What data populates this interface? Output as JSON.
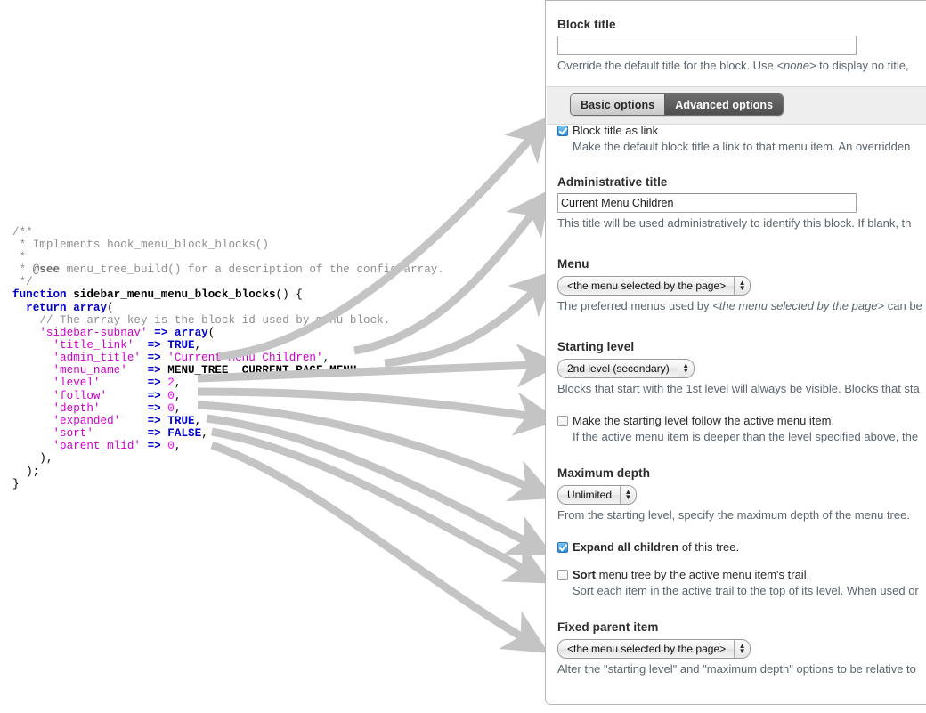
{
  "code": {
    "language": "php",
    "lines": [
      "/**",
      " * Implements hook_menu_block_blocks()",
      " *",
      " * @see menu_tree_build() for a description of the config array.",
      " */",
      "function sidebar_menu_menu_block_blocks() {",
      "  return array(",
      "    // The array key is the block id used by menu block.",
      "    'sidebar-subnav' => array(",
      "      'title_link'   => TRUE,",
      "      'admin_title'  => 'Current Menu Children',",
      "      'menu_name'    => MENU_TREE__CURRENT_PAGE_MENU,",
      "      'level'        => 2,",
      "      'follow'       => 0,",
      "      'depth'        => 0,",
      "      'expanded'     => TRUE,",
      "      'sort'         => FALSE,",
      "      'parent_mlid'  => 0,",
      "    ),",
      "  );",
      "}"
    ]
  },
  "panel": {
    "block_title": {
      "label": "Block title",
      "value": "",
      "placeholder": "",
      "description": "Override the default title for the block. Use <none> to display no title,",
      "description_pre": "Override the default title for the block. Use ",
      "description_em": "<none>",
      "description_post": " to display no title,"
    },
    "tabs": [
      {
        "label": "Basic options",
        "selected": false
      },
      {
        "label": "Advanced options",
        "selected": true
      }
    ],
    "title_link": {
      "label": "Block title as link",
      "checked": true,
      "description": "Make the default block title a link to that menu item. An overridden"
    },
    "admin_title": {
      "label": "Administrative title",
      "value": "Current Menu Children",
      "description": "This title will be used administratively to identify this block. If blank, th"
    },
    "menu": {
      "label": "Menu",
      "value": "<the menu selected by the page>",
      "description_pre": "The preferred menus used by ",
      "description_em": "<the menu selected by the page>",
      "description_post": " can be"
    },
    "starting_level": {
      "label": "Starting level",
      "value": "2nd level (secondary)",
      "description": "Blocks that start with the 1st level will always be visible. Blocks that sta"
    },
    "follow": {
      "label": "Make the starting level follow the active menu item.",
      "checked": false,
      "description": "If the active menu item is deeper than the level specified above, the"
    },
    "maximum_depth": {
      "label": "Maximum depth",
      "value": "Unlimited",
      "description": "From the starting level, specify the maximum depth of the menu tree."
    },
    "expanded": {
      "label_bold": "Expand all children",
      "label_rest": " of this tree.",
      "checked": true
    },
    "sort": {
      "label_bold": "Sort",
      "label_rest": " menu tree by the active menu item's trail.",
      "checked": false,
      "description": "Sort each item in the active trail to the top of its level. When used or"
    },
    "fixed_parent": {
      "label": "Fixed parent item",
      "value": "<the menu selected by the page>",
      "description": "Alter the \"starting level\" and \"maximum depth\" options to be relative to"
    }
  },
  "colors": {
    "arrow": "#c4c4c4",
    "panel_border": "#b6b6b6",
    "tab_band": "#eeeeee",
    "tab_selected_bg": "#585858",
    "checkbox_checked": "#2a8fd4",
    "heading": "#2d2d2d",
    "description": "#5b6670",
    "code_string": "#cc00cc",
    "code_number": "#ff00ff",
    "code_keyword": "#0000cc",
    "code_comment": "#8f8f8f"
  },
  "icons": {
    "select_stepper": "up-down-stepper-icon",
    "checkmark": "check-icon"
  }
}
